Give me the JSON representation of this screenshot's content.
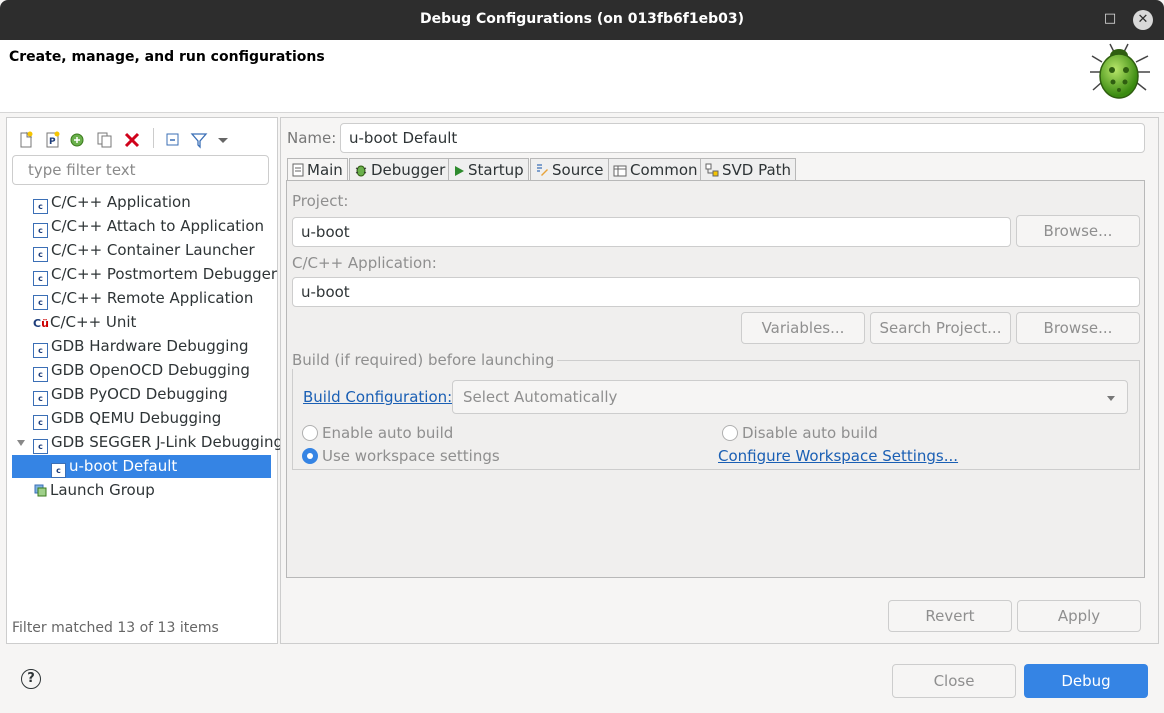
{
  "window": {
    "title": "Debug Configurations  (on 013fb6f1eb03)"
  },
  "header": {
    "description": "Create, manage, and run configurations"
  },
  "filter": {
    "placeholder": "type filter text",
    "status": "Filter matched 13 of 13 items"
  },
  "tree": [
    {
      "label": "C/C++ Application",
      "icon": "c-app-icon"
    },
    {
      "label": "C/C++ Attach to Application",
      "icon": "c-app-icon"
    },
    {
      "label": "C/C++ Container Launcher",
      "icon": "c-app-icon"
    },
    {
      "label": "C/C++ Postmortem Debugger",
      "icon": "c-app-icon"
    },
    {
      "label": "C/C++ Remote Application",
      "icon": "c-app-icon"
    },
    {
      "label": "C/C++ Unit",
      "icon": "c-unit-icon"
    },
    {
      "label": "GDB Hardware Debugging",
      "icon": "c-app-icon"
    },
    {
      "label": "GDB OpenOCD Debugging",
      "icon": "c-app-icon"
    },
    {
      "label": "GDB PyOCD Debugging",
      "icon": "c-app-icon"
    },
    {
      "label": "GDB QEMU Debugging",
      "icon": "c-app-icon"
    },
    {
      "label": "GDB SEGGER J-Link Debugging",
      "icon": "c-app-icon"
    },
    {
      "label": "u-boot Default",
      "icon": "c-app-icon",
      "selected": true
    },
    {
      "label": "Launch Group",
      "icon": "launch-group-icon"
    }
  ],
  "config": {
    "name_label": "Name:",
    "name": "u-boot Default",
    "tabs": [
      "Main",
      "Debugger",
      "Startup",
      "Source",
      "Common",
      "SVD Path"
    ],
    "project_label": "Project:",
    "project": "u-boot",
    "browse": "Browse...",
    "app_label": "C/C++ Application:",
    "app": "u-boot",
    "variables": "Variables...",
    "search_project": "Search Project...",
    "build_group": "Build (if required) before launching",
    "build_config_label": "Build Configuration:",
    "build_config_value": "Select Automatically",
    "enable_auto": "Enable auto build",
    "disable_auto": "Disable auto build",
    "use_workspace": "Use workspace settings",
    "configure_ws": "Configure Workspace Settings...",
    "revert": "Revert",
    "apply": "Apply"
  },
  "footer": {
    "close": "Close",
    "debug": "Debug",
    "help": "?"
  },
  "colors": {
    "accent": "#3584e4",
    "link": "#1a5fb4",
    "titlebar": "#2d2d2d"
  }
}
